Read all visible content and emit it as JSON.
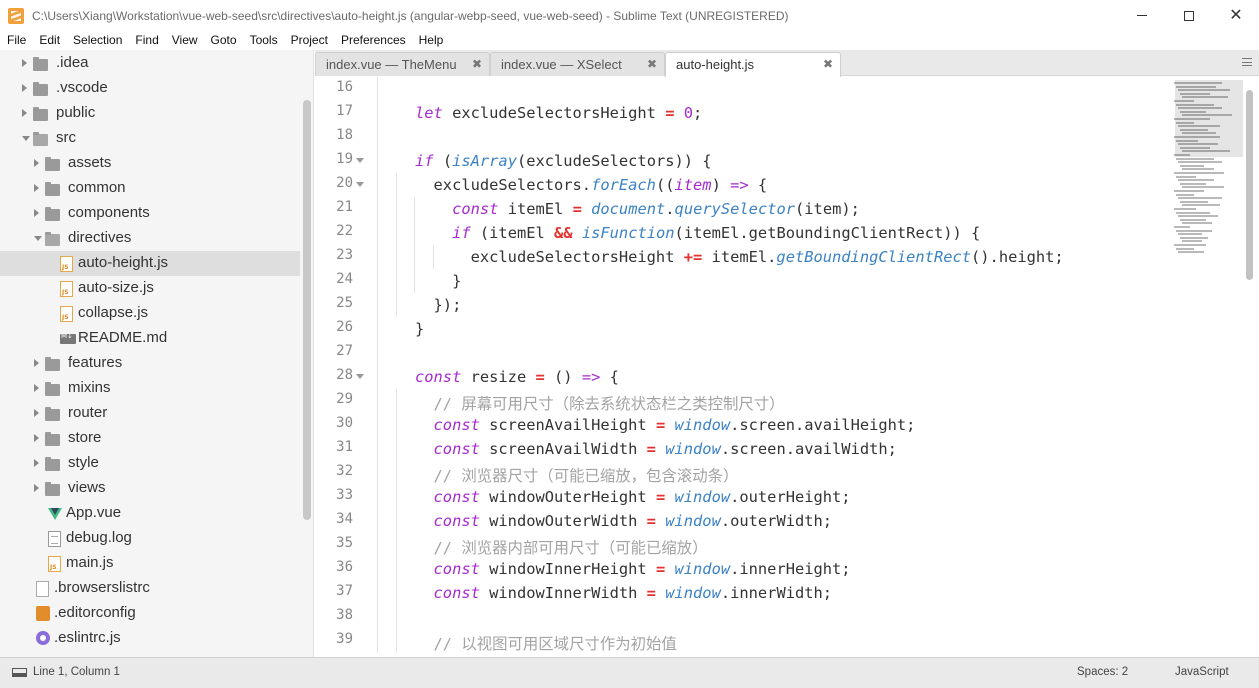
{
  "window": {
    "title": "C:\\Users\\Xiang\\Workstation\\vue-web-seed\\src\\directives\\auto-height.js (angular-webp-seed, vue-web-seed) - Sublime Text (UNREGISTERED)"
  },
  "menu": [
    "File",
    "Edit",
    "Selection",
    "Find",
    "View",
    "Goto",
    "Tools",
    "Project",
    "Preferences",
    "Help"
  ],
  "sidebar": {
    "items": [
      {
        "label": ".idea",
        "type": "folder",
        "state": "closed"
      },
      {
        "label": ".vscode",
        "type": "folder",
        "state": "closed"
      },
      {
        "label": "public",
        "type": "folder",
        "state": "closed"
      },
      {
        "label": "src",
        "type": "folder",
        "state": "open"
      },
      {
        "label": "assets",
        "type": "folder",
        "state": "closed"
      },
      {
        "label": "common",
        "type": "folder",
        "state": "closed"
      },
      {
        "label": "components",
        "type": "folder",
        "state": "closed"
      },
      {
        "label": "directives",
        "type": "folder",
        "state": "open"
      },
      {
        "label": "auto-height.js",
        "type": "js",
        "selected": true
      },
      {
        "label": "auto-size.js",
        "type": "js"
      },
      {
        "label": "collapse.js",
        "type": "js"
      },
      {
        "label": "README.md",
        "type": "md"
      },
      {
        "label": "features",
        "type": "folder",
        "state": "closed"
      },
      {
        "label": "mixins",
        "type": "folder",
        "state": "closed"
      },
      {
        "label": "router",
        "type": "folder",
        "state": "closed"
      },
      {
        "label": "store",
        "type": "folder",
        "state": "closed"
      },
      {
        "label": "style",
        "type": "folder",
        "state": "closed"
      },
      {
        "label": "views",
        "type": "folder",
        "state": "closed"
      },
      {
        "label": "App.vue",
        "type": "vue"
      },
      {
        "label": "debug.log",
        "type": "log"
      },
      {
        "label": "main.js",
        "type": "js"
      },
      {
        "label": ".browserslistrc",
        "type": "rc"
      },
      {
        "label": ".editorconfig",
        "type": "editorconfig"
      },
      {
        "label": ".eslintrc.js",
        "type": "eslint"
      }
    ]
  },
  "tabs": [
    {
      "label": "index.vue — TheMenu",
      "active": false
    },
    {
      "label": "index.vue — XSelect",
      "active": false
    },
    {
      "label": "auto-height.js",
      "active": true
    }
  ],
  "editor": {
    "lines": [
      {
        "n": "16",
        "fold": false,
        "indent": 0,
        "tokens": []
      },
      {
        "n": "17",
        "fold": false,
        "indent": 1,
        "tokens": [
          [
            "kw",
            "let"
          ],
          [
            "pl",
            " excludeSelectorsHeight "
          ],
          [
            "op",
            "="
          ],
          [
            "pl",
            " "
          ],
          [
            "num",
            "0"
          ],
          [
            "pl",
            ";"
          ]
        ]
      },
      {
        "n": "18",
        "fold": false,
        "indent": 0,
        "tokens": []
      },
      {
        "n": "19",
        "fold": true,
        "indent": 1,
        "tokens": [
          [
            "kw",
            "if"
          ],
          [
            "pl",
            " ("
          ],
          [
            "fn",
            "isArray"
          ],
          [
            "pl",
            "(excludeSelectors)) {"
          ]
        ]
      },
      {
        "n": "20",
        "fold": true,
        "indent": 2,
        "tokens": [
          [
            "pl",
            "excludeSelectors."
          ],
          [
            "fn",
            "forEach"
          ],
          [
            "pl",
            "(("
          ],
          [
            "param",
            "item"
          ],
          [
            "pl",
            ") "
          ],
          [
            "kw",
            "=>"
          ],
          [
            "pl",
            " {"
          ]
        ]
      },
      {
        "n": "21",
        "fold": false,
        "indent": 3,
        "tokens": [
          [
            "kw",
            "const"
          ],
          [
            "pl",
            " itemEl "
          ],
          [
            "op",
            "="
          ],
          [
            "pl",
            " "
          ],
          [
            "obj",
            "document"
          ],
          [
            "pl",
            "."
          ],
          [
            "fn",
            "querySelector"
          ],
          [
            "pl",
            "(item);"
          ]
        ]
      },
      {
        "n": "22",
        "fold": false,
        "indent": 3,
        "tokens": [
          [
            "kw",
            "if"
          ],
          [
            "pl",
            " (itemEl "
          ],
          [
            "op",
            "&&"
          ],
          [
            "pl",
            " "
          ],
          [
            "fn",
            "isFunction"
          ],
          [
            "pl",
            "(itemEl.getBoundingClientRect)) {"
          ]
        ]
      },
      {
        "n": "23",
        "fold": false,
        "indent": 4,
        "tokens": [
          [
            "pl",
            "excludeSelectorsHeight "
          ],
          [
            "op",
            "+="
          ],
          [
            "pl",
            " itemEl."
          ],
          [
            "fn",
            "getBoundingClientRect"
          ],
          [
            "pl",
            "().height;"
          ]
        ]
      },
      {
        "n": "24",
        "fold": false,
        "indent": 3,
        "tokens": [
          [
            "pl",
            "}"
          ]
        ]
      },
      {
        "n": "25",
        "fold": false,
        "indent": 2,
        "tokens": [
          [
            "pl",
            "});"
          ]
        ]
      },
      {
        "n": "26",
        "fold": false,
        "indent": 1,
        "tokens": [
          [
            "pl",
            "}"
          ]
        ]
      },
      {
        "n": "27",
        "fold": false,
        "indent": 0,
        "tokens": []
      },
      {
        "n": "28",
        "fold": true,
        "indent": 1,
        "tokens": [
          [
            "kw",
            "const"
          ],
          [
            "pl",
            " resize "
          ],
          [
            "op",
            "="
          ],
          [
            "pl",
            " () "
          ],
          [
            "kw",
            "=>"
          ],
          [
            "pl",
            " {"
          ]
        ]
      },
      {
        "n": "29",
        "fold": false,
        "indent": 2,
        "tokens": [
          [
            "cm",
            "// 屏幕可用尺寸（除去系统状态栏之类控制尺寸）"
          ]
        ]
      },
      {
        "n": "30",
        "fold": false,
        "indent": 2,
        "tokens": [
          [
            "kw",
            "const"
          ],
          [
            "pl",
            " screenAvailHeight "
          ],
          [
            "op",
            "="
          ],
          [
            "pl",
            " "
          ],
          [
            "obj",
            "window"
          ],
          [
            "pl",
            ".screen.availHeight;"
          ]
        ]
      },
      {
        "n": "31",
        "fold": false,
        "indent": 2,
        "tokens": [
          [
            "kw",
            "const"
          ],
          [
            "pl",
            " screenAvailWidth "
          ],
          [
            "op",
            "="
          ],
          [
            "pl",
            " "
          ],
          [
            "obj",
            "window"
          ],
          [
            "pl",
            ".screen.availWidth;"
          ]
        ]
      },
      {
        "n": "32",
        "fold": false,
        "indent": 2,
        "tokens": [
          [
            "cm",
            "// 浏览器尺寸（可能已缩放，包含滚动条）"
          ]
        ]
      },
      {
        "n": "33",
        "fold": false,
        "indent": 2,
        "tokens": [
          [
            "kw",
            "const"
          ],
          [
            "pl",
            " windowOuterHeight "
          ],
          [
            "op",
            "="
          ],
          [
            "pl",
            " "
          ],
          [
            "obj",
            "window"
          ],
          [
            "pl",
            ".outerHeight;"
          ]
        ]
      },
      {
        "n": "34",
        "fold": false,
        "indent": 2,
        "tokens": [
          [
            "kw",
            "const"
          ],
          [
            "pl",
            " windowOuterWidth "
          ],
          [
            "op",
            "="
          ],
          [
            "pl",
            " "
          ],
          [
            "obj",
            "window"
          ],
          [
            "pl",
            ".outerWidth;"
          ]
        ]
      },
      {
        "n": "35",
        "fold": false,
        "indent": 2,
        "tokens": [
          [
            "cm",
            "// 浏览器内部可用尺寸（可能已缩放）"
          ]
        ]
      },
      {
        "n": "36",
        "fold": false,
        "indent": 2,
        "tokens": [
          [
            "kw",
            "const"
          ],
          [
            "pl",
            " windowInnerHeight "
          ],
          [
            "op",
            "="
          ],
          [
            "pl",
            " "
          ],
          [
            "obj",
            "window"
          ],
          [
            "pl",
            ".innerHeight;"
          ]
        ]
      },
      {
        "n": "37",
        "fold": false,
        "indent": 2,
        "tokens": [
          [
            "kw",
            "const"
          ],
          [
            "pl",
            " windowInnerWidth "
          ],
          [
            "op",
            "="
          ],
          [
            "pl",
            " "
          ],
          [
            "obj",
            "window"
          ],
          [
            "pl",
            ".innerWidth;"
          ]
        ]
      },
      {
        "n": "38",
        "fold": false,
        "indent": 0,
        "tokens": []
      },
      {
        "n": "39",
        "fold": false,
        "indent": 2,
        "tokens": [
          [
            "cm",
            "// 以视图可用区域尺寸作为初始值"
          ]
        ]
      }
    ]
  },
  "status": {
    "position": "Line 1, Column 1",
    "spaces": "Spaces: 2",
    "syntax": "JavaScript"
  },
  "colors": {
    "keyword": "#a72ad0",
    "operator": "#e2312e",
    "function": "#3b82c4",
    "comment": "#a3a3a3",
    "selection": "#dedede"
  }
}
